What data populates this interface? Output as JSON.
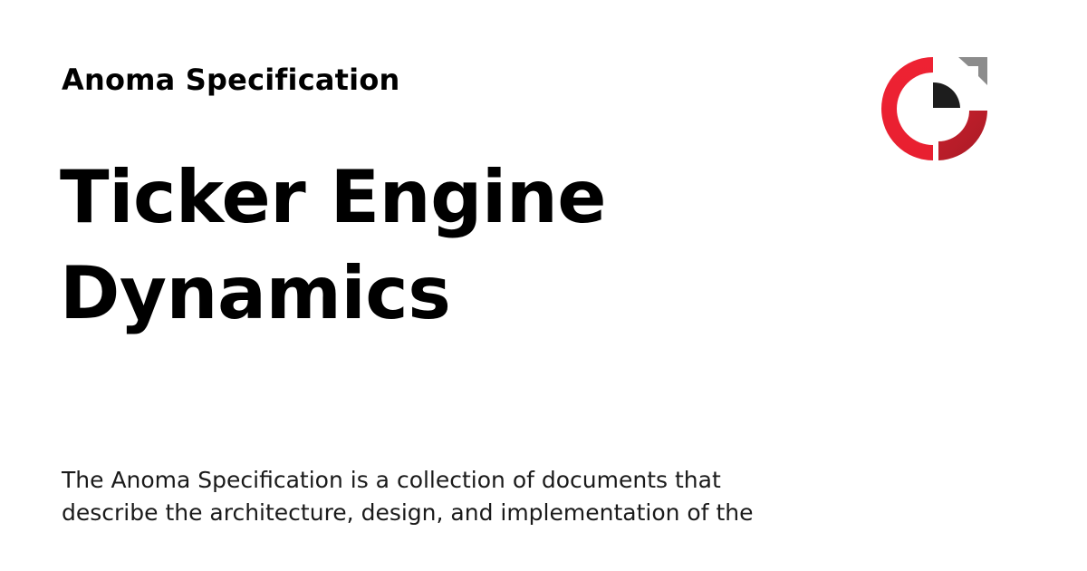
{
  "header": {
    "site_name": "Anoma Specification"
  },
  "title": {
    "line1": "Ticker Engine",
    "line2": "Dynamics"
  },
  "description": {
    "line1": "The Anoma Specification is a collection of documents that",
    "line2": "describe the architecture, design, and implementation of the"
  },
  "logo": {
    "icon": "anoma-logo-icon",
    "colors": {
      "red": "#ee2233",
      "dark_red": "#b81e2a",
      "grey": "#8c8c8c",
      "black": "#1d1d1d"
    }
  }
}
